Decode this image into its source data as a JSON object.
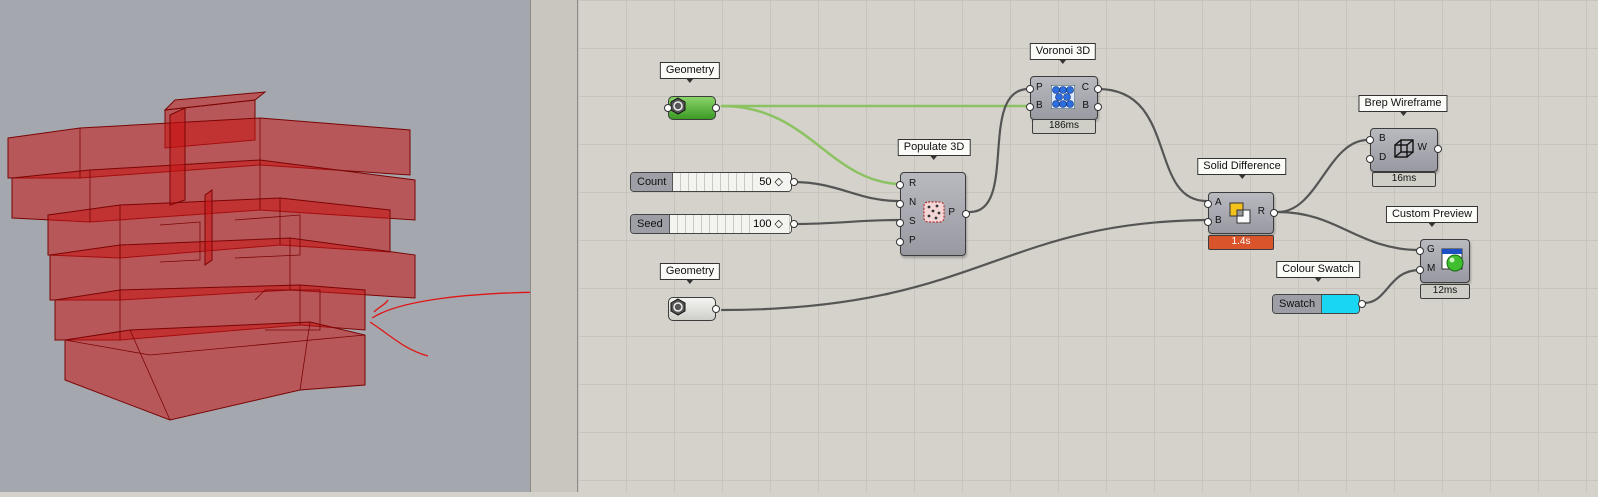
{
  "nodes": {
    "geometry_top": {
      "label": "Geometry"
    },
    "voronoi": {
      "label": "Voronoi 3D",
      "inputs": [
        "P",
        "B"
      ],
      "outputs": [
        "C",
        "B"
      ],
      "timer": "186ms"
    },
    "populate": {
      "label": "Populate 3D",
      "inputs": [
        "R",
        "N",
        "S",
        "P"
      ],
      "outputs": [
        "P"
      ]
    },
    "count_slider": {
      "name": "Count",
      "value": "50 ◇"
    },
    "seed_slider": {
      "name": "Seed",
      "value": "100 ◇"
    },
    "solid_difference": {
      "label": "Solid Difference",
      "inputs": [
        "A",
        "B"
      ],
      "outputs": [
        "R"
      ],
      "timer": "1.4s"
    },
    "brep_wireframe": {
      "label": "Brep Wireframe",
      "inputs": [
        "B",
        "D"
      ],
      "outputs": [
        "W"
      ],
      "timer": "16ms"
    },
    "custom_preview": {
      "label": "Custom Preview",
      "inputs": [
        "G",
        "M"
      ],
      "timer": "12ms"
    },
    "colour_swatch": {
      "label": "Colour Swatch",
      "name": "Swatch"
    },
    "geometry_bottom": {
      "label": "Geometry"
    }
  },
  "colors": {
    "swatch_color": "#19d6f2",
    "geometry_param_green": "#4caa2e",
    "solid_difference_timer": "#d9542a",
    "wire_selected": "#8cc262",
    "wire": "#555555",
    "annotation_red": "#e01414",
    "preview_red": "#c81818"
  }
}
